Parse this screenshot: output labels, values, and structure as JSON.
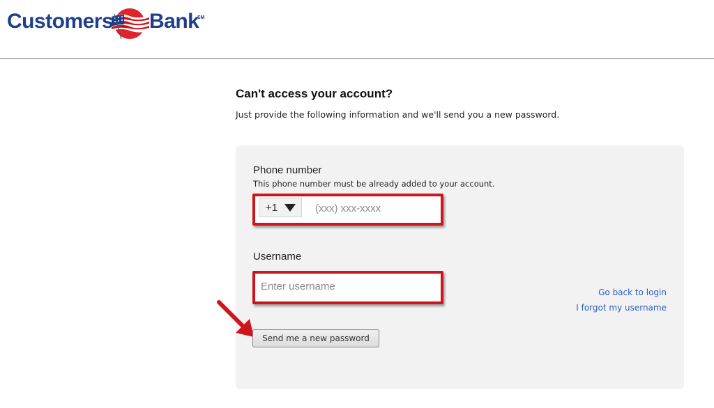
{
  "brand": {
    "name_part1": "Customers",
    "name_part2": "Bank",
    "service_mark": "SM",
    "colors": {
      "blue": "#1f3f8c",
      "red": "#d1141b"
    }
  },
  "page": {
    "title": "Can't access your account?",
    "subtitle": "Just provide the following information and we'll send you a new password."
  },
  "form": {
    "phone": {
      "label": "Phone number",
      "hint": "This phone number must be already added to your account.",
      "country_code": "+1",
      "placeholder": "(xxx) xxx-xxxx",
      "value": ""
    },
    "username": {
      "label": "Username",
      "placeholder": "Enter username",
      "value": ""
    },
    "submit_label": "Send me a new password"
  },
  "links": {
    "back_to_login": "Go back to login",
    "forgot_username": "I forgot my username"
  },
  "annotations": {
    "highlight_color": "#d1141b",
    "arrow_icon": "red-arrow-icon"
  }
}
